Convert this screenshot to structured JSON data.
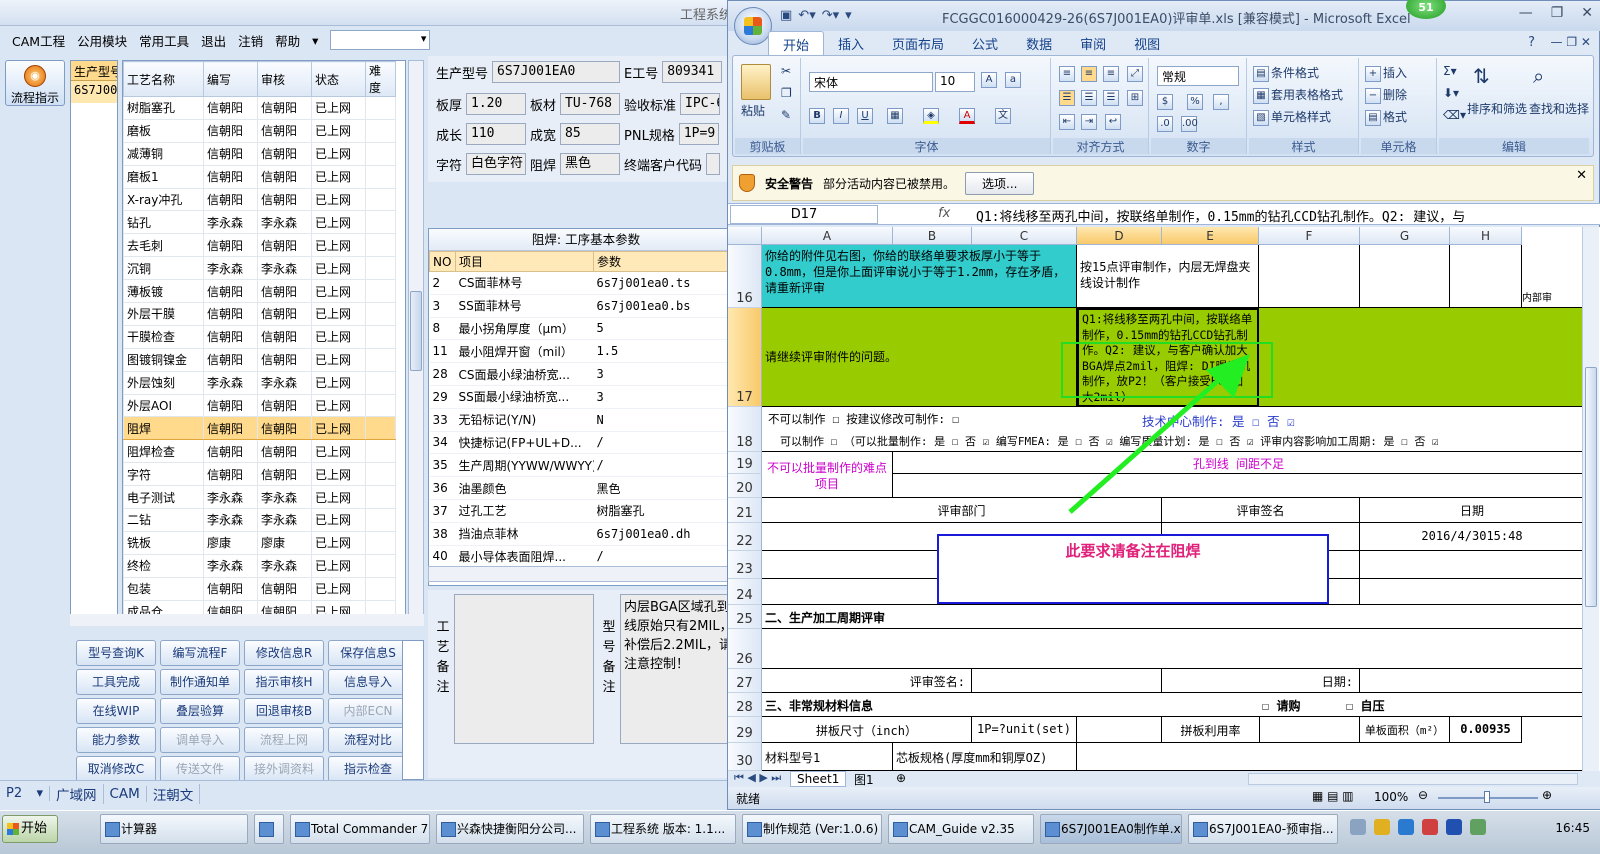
{
  "cam": {
    "title": "工程系统",
    "menu": [
      "CAM工程",
      "公用模块",
      "常用工具",
      "退出",
      "注销",
      "帮助"
    ],
    "menu_combo_value": "",
    "flow_button": "流程指示",
    "model_header": "生产型号",
    "model_value": "6S7J001EA0",
    "process_columns": [
      "工艺名称",
      "编写",
      "审核",
      "状态",
      "难度"
    ],
    "process_rows": [
      [
        "树脂塞孔",
        "信朝阳",
        "信朝阳",
        "已上网",
        ""
      ],
      [
        "磨板",
        "信朝阳",
        "信朝阳",
        "已上网",
        ""
      ],
      [
        "减薄铜",
        "信朝阳",
        "信朝阳",
        "已上网",
        ""
      ],
      [
        "磨板1",
        "信朝阳",
        "信朝阳",
        "已上网",
        ""
      ],
      [
        "X-ray冲孔",
        "信朝阳",
        "信朝阳",
        "已上网",
        ""
      ],
      [
        "钻孔",
        "李永森",
        "李永森",
        "已上网",
        ""
      ],
      [
        "去毛刺",
        "信朝阳",
        "信朝阳",
        "已上网",
        ""
      ],
      [
        "沉铜",
        "李永森",
        "李永森",
        "已上网",
        ""
      ],
      [
        "薄板镀",
        "信朝阳",
        "信朝阳",
        "已上网",
        ""
      ],
      [
        "外层干膜",
        "信朝阳",
        "信朝阳",
        "已上网",
        ""
      ],
      [
        "干膜检查",
        "信朝阳",
        "信朝阳",
        "已上网",
        ""
      ],
      [
        "图镀铜镍金",
        "信朝阳",
        "信朝阳",
        "已上网",
        ""
      ],
      [
        "外层蚀刻",
        "李永森",
        "李永森",
        "已上网",
        ""
      ],
      [
        "外层AOI",
        "信朝阳",
        "信朝阳",
        "已上网",
        ""
      ],
      [
        "阻焊",
        "信朝阳",
        "信朝阳",
        "已上网",
        ""
      ],
      [
        "阻焊检查",
        "信朝阳",
        "信朝阳",
        "已上网",
        ""
      ],
      [
        "字符",
        "信朝阳",
        "信朝阳",
        "已上网",
        ""
      ],
      [
        "电子测试",
        "李永森",
        "李永森",
        "已上网",
        ""
      ],
      [
        "二钻",
        "李永森",
        "李永森",
        "已上网",
        ""
      ],
      [
        "铣板",
        "廖康",
        "廖康",
        "已上网",
        ""
      ],
      [
        "终检",
        "李永森",
        "李永森",
        "已上网",
        ""
      ],
      [
        "包装",
        "信朝阳",
        "信朝阳",
        "已上网",
        ""
      ],
      [
        "成品仓",
        "信朝阳",
        "信朝阳",
        "已上网",
        ""
      ]
    ],
    "selected_row": 14,
    "buttons": [
      {
        "label": "型号查询K",
        "enabled": true
      },
      {
        "label": "编写流程F",
        "enabled": true
      },
      {
        "label": "修改信息R",
        "enabled": true
      },
      {
        "label": "保存信息S",
        "enabled": true
      },
      {
        "label": "工具完成",
        "enabled": true
      },
      {
        "label": "制作通知单",
        "enabled": true
      },
      {
        "label": "指示审核H",
        "enabled": true
      },
      {
        "label": "信息导入",
        "enabled": true
      },
      {
        "label": "在线WIP",
        "enabled": true
      },
      {
        "label": "叠层验算",
        "enabled": true
      },
      {
        "label": "回退审核B",
        "enabled": true
      },
      {
        "label": "内部ECN",
        "enabled": false
      },
      {
        "label": "能力参数",
        "enabled": true
      },
      {
        "label": "调单导入",
        "enabled": false
      },
      {
        "label": "流程上网",
        "enabled": false
      },
      {
        "label": "流程对比",
        "enabled": true
      },
      {
        "label": "取消修改C",
        "enabled": true
      },
      {
        "label": "传送文件",
        "enabled": false
      },
      {
        "label": "接外调资料",
        "enabled": false
      },
      {
        "label": "指示检查",
        "enabled": true
      }
    ],
    "info": {
      "model_label": "生产型号",
      "model_value": "6S7J001EA0",
      "eno_label": "E工号",
      "eno_value": "809341",
      "thick_label": "板厚",
      "thick_value": "1.20",
      "material_label": "板材",
      "material_value": "TU-768",
      "accept_label": "验收标准",
      "accept_value": "IPC-6",
      "grow_label": "成长",
      "grow_value": "110",
      "width_label": "成宽",
      "width_value": "85",
      "pnl_label": "PNL规格",
      "pnl_value": "1P=9",
      "char_label": "字符",
      "char_value": "白色字符",
      "mask_label": "阻焊",
      "mask_value": "黑色",
      "customer_label": "终端客户代码",
      "customer_value": ""
    },
    "params": {
      "title": "阻焊: 工序基本参数",
      "columns": [
        "NO",
        "项目",
        "参数"
      ],
      "rows": [
        [
          "2",
          "CS面菲林号",
          "6s7j001ea0.ts"
        ],
        [
          "3",
          "SS面菲林号",
          "6s7j001ea0.bs"
        ],
        [
          "8",
          "最小拐角厚度（μm）",
          "5"
        ],
        [
          "11",
          "最小阻焊开窗（mil）",
          "1.5"
        ],
        [
          "28",
          "CS面最小绿油桥宽...",
          "3"
        ],
        [
          "29",
          "SS面最小绿油桥宽...",
          "3"
        ],
        [
          "33",
          "无铅标记(Y/N)",
          "N"
        ],
        [
          "34",
          "快捷标记(FP+UL+D...",
          "/"
        ],
        [
          "35",
          "生产周期(YYWW/WWYY)",
          "/"
        ],
        [
          "36",
          "油墨颜色",
          "黑色"
        ],
        [
          "37",
          "过孔工艺",
          "树脂塞孔"
        ],
        [
          "38",
          "挡油点菲林",
          "6s7j001ea0.dh"
        ],
        [
          "40",
          "最小导体表面阻焊...",
          "/"
        ]
      ]
    },
    "notes": {
      "label1": [
        "工",
        "艺",
        "备",
        "注"
      ],
      "label2": [
        "型",
        "号",
        "备",
        "注"
      ],
      "text2": "内层BGA区域孔到线原始只有2MIL，补偿后2.2MIL，请注意控制！"
    },
    "status_tabs": [
      "P2",
      "广域网",
      "CAM",
      "汪朝文"
    ]
  },
  "excel": {
    "title": "FCGGC016000429-26(6S7J001EA0)评审单.xls  [兼容模式] - Microsoft Excel",
    "badge": "51",
    "tabs": [
      "开始",
      "插入",
      "页面布局",
      "公式",
      "数据",
      "审阅",
      "视图"
    ],
    "ribbon": {
      "clipboard_label": "剪贴板",
      "paste": "粘贴",
      "font_label": "字体",
      "font_name": "宋体",
      "font_size": "10",
      "align_label": "对齐方式",
      "number_label": "数字",
      "number_format": "常规",
      "styles_label": "样式",
      "cond_format": "条件格式",
      "table_format": "套用表格格式",
      "cell_style": "单元格样式",
      "cells_label": "单元格",
      "insert": "插入",
      "delete": "删除",
      "format": "格式",
      "edit_label": "编辑",
      "sort": "排序和筛选",
      "find": "查找和选择"
    },
    "security": {
      "title": "安全警告",
      "text": "部分活动内容已被禁用。",
      "options": "选项..."
    },
    "name_box": "D17",
    "formula": "Q1:将线移至两孔中间，按联络单制作，0.15mm的钻孔CCD钻孔制作。Q2: 建议，与",
    "columns": [
      "A",
      "B",
      "C",
      "D",
      "E",
      "F",
      "G",
      "H"
    ],
    "rows": {
      "r16_a": "你给的附件见右图，你给的联络单要求板厚小于等于0.8mm，但是你上面评审说小于等于1.2mm，存在矛盾，请重新评审",
      "r16_d": "按15点评审制作，内层无焊盘夹线设计制作",
      "r16_i": "内部审",
      "r17_a": "请继续评审附件的问题。",
      "r17_d": "Q1:将线移至两孔中间，按联络单制作，0.15mm的钻孔CCD钻孔制作。Q2: 建议，与客户确认加大BGA焊点2mil，阻焊: DI曝光机制作，放P2！（客户接受BGA加大2mil）",
      "r18_line1": "不可以制作 ☐  按建议修改可制作: ☐",
      "r18_tech": "技术中心制作: 是 ☐ 否 ☑",
      "r18_line2": "可以制作 ☐ （可以批量制作: 是 ☐ 否 ☑  编写FMEA: 是 ☐ 否 ☑  编写质量计划: 是 ☐ 否 ☑  评审内容影响加工周期: 是 ☐ 否 ☑",
      "r19_a": "不可以批量制作的难点项目",
      "r19_d": "孔到线  间距不足",
      "r21_dept": "评审部门",
      "r21_sign": "评审签名",
      "r21_date": "日期",
      "r22_date": "2016/4/3015:48",
      "r25_a": "二、生产加工周期评审",
      "r27_sign": "评审签名:",
      "r27_date": "日期:",
      "r28_a": "三、非常规材料信息",
      "r28_purchase": "☐ 请购",
      "r28_self": "☐ 自压",
      "r29_a": "拼板尺寸（inch）",
      "r29_c": "1P=?unit(set)",
      "r29_e": "拼板利用率",
      "r29_g": "单板面积（m²）",
      "r29_h": "0.00935",
      "r30_a": "材料型号1",
      "r30_b": "芯板规格(厚度mm和铜厚OZ)"
    },
    "row_numbers": [
      "16",
      "17",
      "18",
      "19",
      "20",
      "21",
      "22",
      "23",
      "24",
      "25",
      "26",
      "27",
      "28",
      "29",
      "30"
    ],
    "annotation": "此要求请备注在阻焊",
    "sheet_tabs": [
      "Sheet1",
      "图1"
    ],
    "status_left": "就绪",
    "zoom": "100%"
  },
  "taskbar": {
    "start": "开始",
    "tasks": [
      "计算器",
      "",
      "Total Commander 7.0 ...",
      "兴森快捷衡阳分公司...",
      "工程系统  版本: 1.1...",
      "制作规范 (Ver:1.0.6)",
      "CAM_Guide v2.35",
      "6S7J001EA0制作单.xl...",
      "6S7J001EA0-预审指..."
    ],
    "clock": "16:45"
  }
}
